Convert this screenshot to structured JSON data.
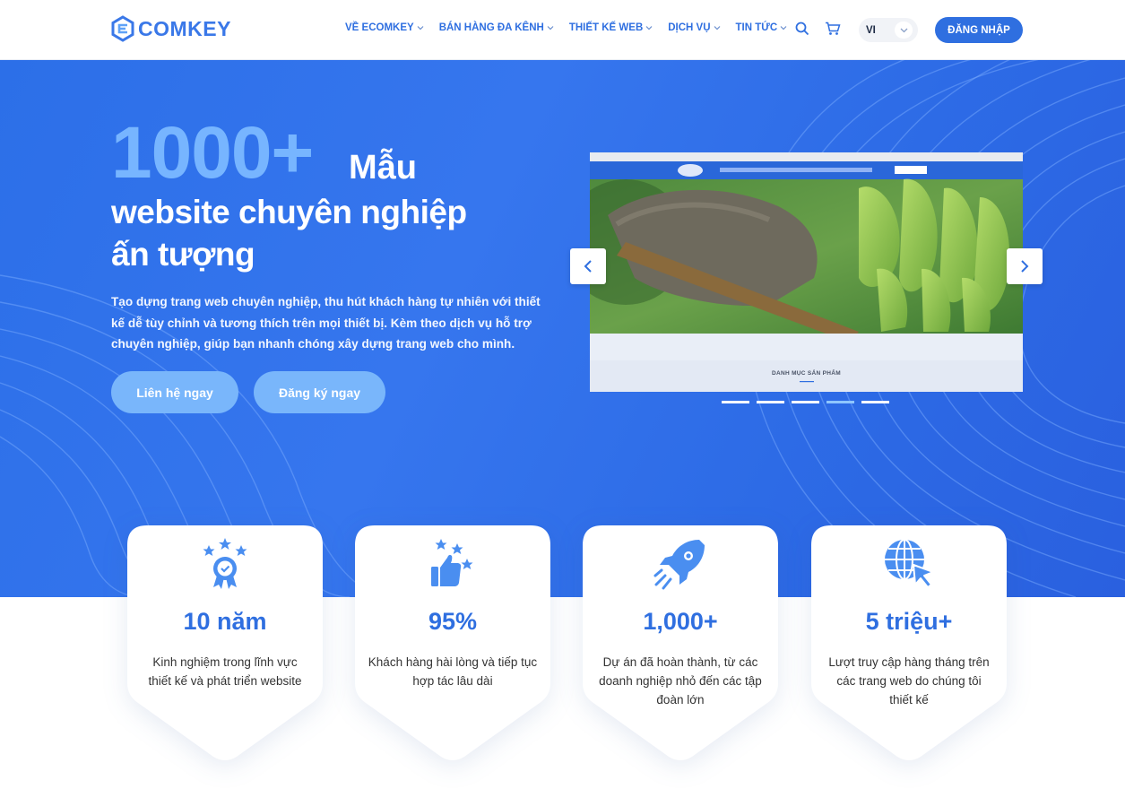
{
  "header": {
    "brand": "COMKEY",
    "nav": [
      {
        "label": "VỀ ECOMKEY"
      },
      {
        "label": "BÁN HÀNG ĐA KÊNH"
      },
      {
        "label": "THIẾT KẾ WEB"
      },
      {
        "label": "DỊCH VỤ"
      },
      {
        "label": "TIN TỨC"
      }
    ],
    "search_icon": "search-icon",
    "cart_icon": "cart-icon",
    "language": "VI",
    "login_label": "ĐĂNG NHẬP"
  },
  "hero": {
    "big_number": "1000+",
    "title_word": "Mẫu",
    "title_line2": "website chuyên nghiệp",
    "title_line3": "ấn tượng",
    "description": "Tạo dựng trang web chuyên nghiệp, thu hút khách hàng tự nhiên với thiết kế dễ tùy chỉnh và tương thích trên mọi thiết bị. Kèm theo dịch vụ hỗ trợ chuyên nghiệp, giúp bạn nhanh chóng xây dựng trang web cho mình.",
    "cta_contact": "Liên hệ ngay",
    "cta_register": "Đăng ký ngay",
    "slider": {
      "caption": "DANH MỤC SẢN PHẨM",
      "dots": 5,
      "active_dot": 4
    }
  },
  "stats": [
    {
      "icon": "award-icon",
      "value": "10 năm",
      "text": "Kinh nghiệm trong lĩnh vực thiết kế và phát triển website"
    },
    {
      "icon": "thumbs-up-icon",
      "value": "95%",
      "text": "Khách hàng hài lòng và tiếp tục hợp tác lâu dài"
    },
    {
      "icon": "rocket-icon",
      "value": "1,000+",
      "text": "Dự án đã hoàn thành, từ các doanh nghiệp nhỏ đến các tập đoàn lớn"
    },
    {
      "icon": "globe-cursor-icon",
      "value": "5 triệu+",
      "text": "Lượt truy cập hàng tháng trên các trang web do chúng tôi thiết kế"
    }
  ],
  "colors": {
    "primary": "#2f6fe0",
    "accent_light": "#77b5ff",
    "button_light": "#79b6fb",
    "icon_blue": "#4a8ef0"
  }
}
